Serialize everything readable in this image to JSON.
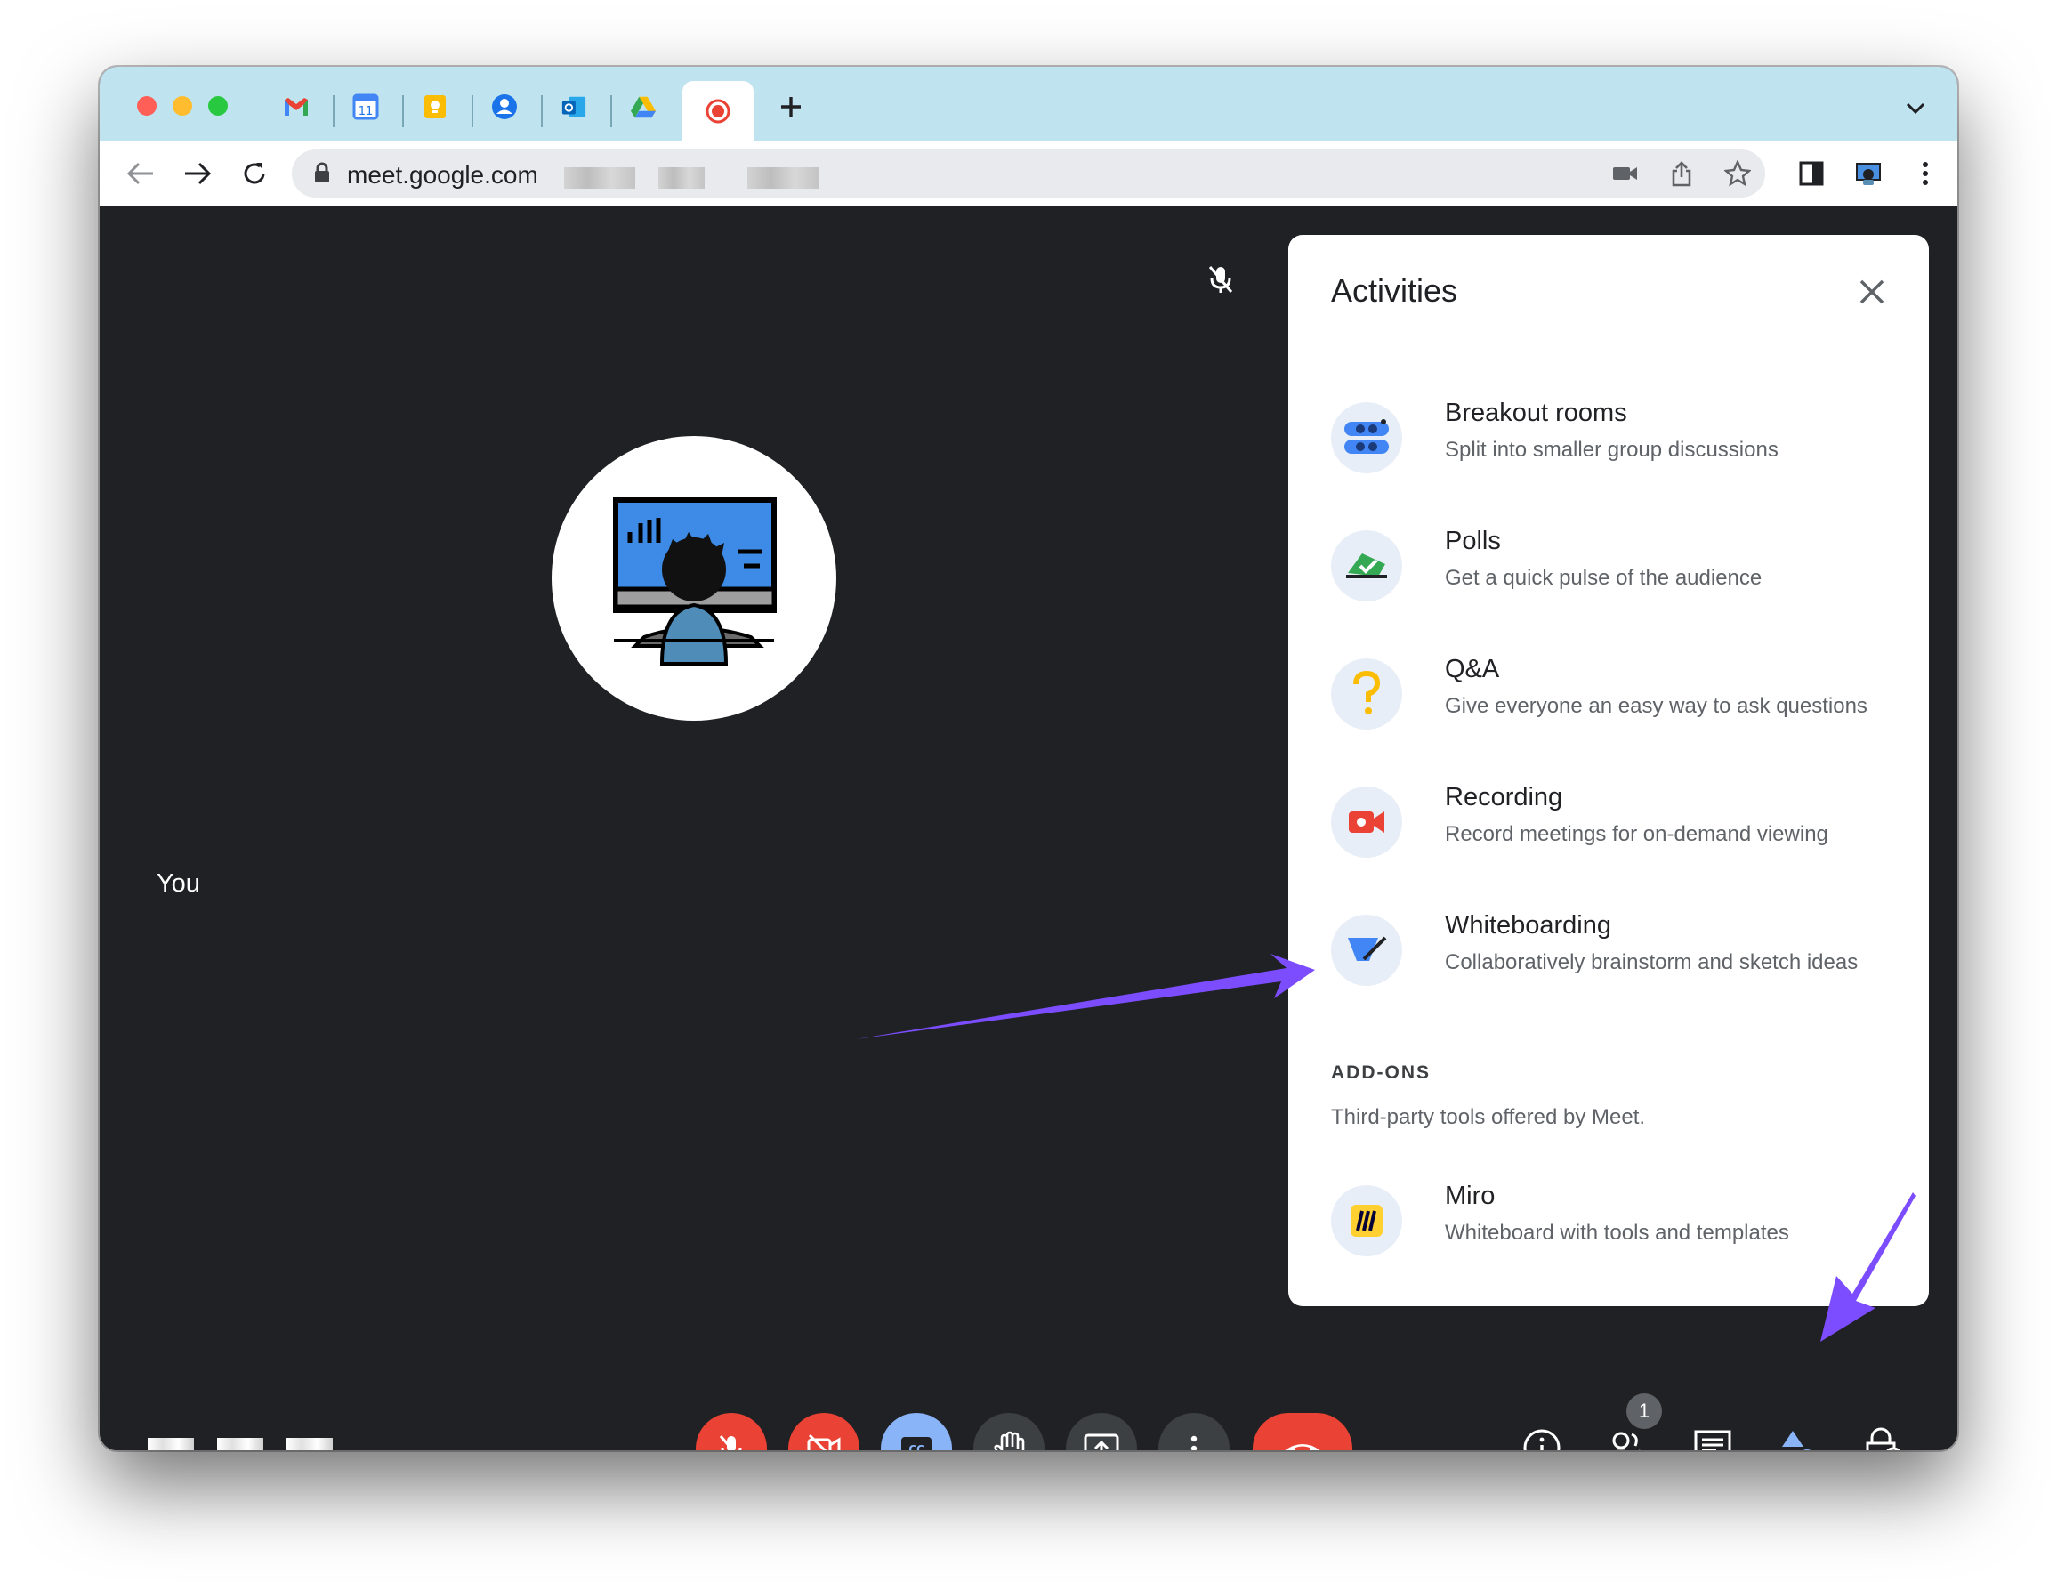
{
  "browser": {
    "url": "meet.google.com",
    "tabs": [
      {
        "icon": "gmail-icon"
      },
      {
        "icon": "calendar-icon",
        "text": "11"
      },
      {
        "icon": "keep-icon"
      },
      {
        "icon": "contacts-icon"
      },
      {
        "icon": "outlook-icon"
      },
      {
        "icon": "drive-icon"
      },
      {
        "icon": "meet-recording-icon",
        "active": true
      }
    ]
  },
  "meeting": {
    "self_label": "You"
  },
  "activities": {
    "title": "Activities",
    "items": [
      {
        "title": "Breakout rooms",
        "description": "Split into smaller group discussions",
        "icon": "breakout-rooms-icon"
      },
      {
        "title": "Polls",
        "description": "Get a quick pulse of the audience",
        "icon": "polls-icon"
      },
      {
        "title": "Q&A",
        "description": "Give everyone an easy way to ask questions",
        "icon": "qa-icon"
      },
      {
        "title": "Recording",
        "description": "Record meetings for on-demand viewing",
        "icon": "recording-icon"
      },
      {
        "title": "Whiteboarding",
        "description": "Collaboratively brainstorm and sketch ideas",
        "icon": "whiteboard-icon"
      }
    ],
    "addons_heading": "ADD-ONS",
    "addons_description": "Third-party tools offered by Meet.",
    "addons": [
      {
        "title": "Miro",
        "description": "Whiteboard with tools and templates",
        "icon": "miro-icon"
      }
    ]
  },
  "controls": {
    "participants_count": "1",
    "cc_label": "CC"
  },
  "colors": {
    "meet_background": "#202124",
    "danger": "#ea4335",
    "accent": "#8ab4f8",
    "annotation_arrow": "#7c4dff",
    "tabstrip": "#bfe4ef"
  }
}
